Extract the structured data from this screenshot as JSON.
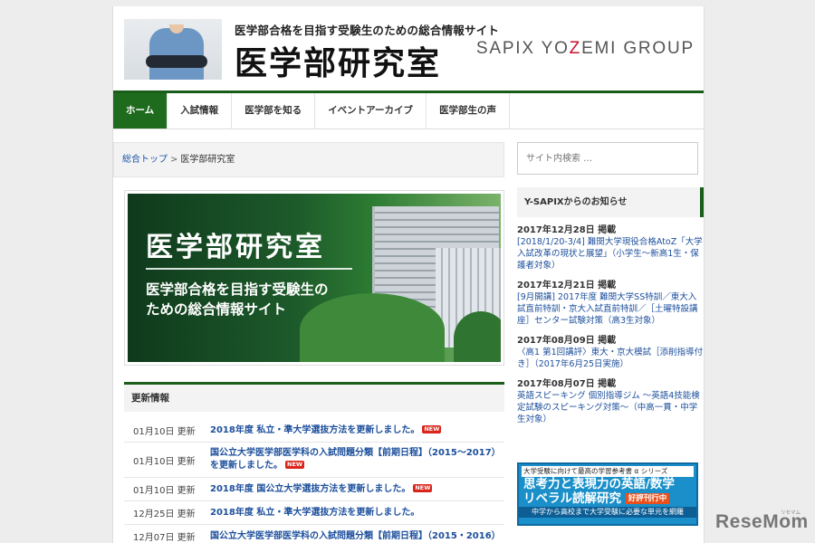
{
  "header": {
    "tagline": "医学部合格を目指す受験生のための総合情報サイト",
    "site_title": "医学部研究室",
    "brand": {
      "prefix": "SAPIX YO",
      "z": "Z",
      "suffix": "EMI GROUP"
    }
  },
  "nav": {
    "items": [
      {
        "label": "ホーム"
      },
      {
        "label": "入試情報"
      },
      {
        "label": "医学部を知る"
      },
      {
        "label": "イベントアーカイブ"
      },
      {
        "label": "医学部生の声"
      }
    ]
  },
  "breadcrumb": {
    "home": "総合トップ",
    "separator": ">",
    "current": "医学部研究室"
  },
  "hero": {
    "title": "医学部研究室",
    "subtitle_line1": "医学部合格を目指す受験生の",
    "subtitle_line2": "ための総合情報サイト"
  },
  "updates": {
    "heading": "更新情報",
    "new_badge": "NEW",
    "rows": [
      {
        "date": "01月10日 更新",
        "text": "2018年度 私立・準大学選抜方法を更新しました。"
      },
      {
        "date": "01月10日 更新",
        "text": "国公立大学医学部医学科の入試問題分類【前期日程】（2015〜2017）を更新しました。"
      },
      {
        "date": "01月10日 更新",
        "text": "2018年度 国公立大学選抜方法を更新しました。"
      },
      {
        "date": "12月25日 更新",
        "text": "2018年度 私立・準大学選抜方法を更新しました。"
      },
      {
        "date": "12月07日 更新",
        "text": "国公立大学医学部医学科の入試問題分類【前期日程】（2015・2016）"
      }
    ]
  },
  "sidebar": {
    "search_placeholder": "サイト内検索 …",
    "news_heading": "Y-SAPIXからのお知らせ",
    "news": [
      {
        "date": "2017年12月28日 掲載",
        "text": "[2018/1/20-3/4] 難関大学現役合格AtoZ「大学入試改革の現状と展望」（小学生～新高1生・保護者対象）"
      },
      {
        "date": "2017年12月21日 掲載",
        "text": "[9月開講] 2017年度 難関大学SS特訓／東大入試直前特訓・京大入試直前特訓／［土曜特設講座］センター試験対策（高3生対象）"
      },
      {
        "date": "2017年08月09日 掲載",
        "text": "〈高1 第1回講評〉東大・京大模試［添削指導付き］（2017年6月25日実施）"
      },
      {
        "date": "2017年08月07日 掲載",
        "text": "英語スピーキング 個別指導ジム ～英語4技能検定試験のスピーキング対策～（中高一貫・中学生対象）"
      }
    ],
    "ad": {
      "top": "大学受験に向けて最高の学習参考書 α シリーズ",
      "line1": "思考力と表現力の英語/数学",
      "line2": "リベラル読解研究",
      "badge": "好評刊行中",
      "bottom": "中学から高校まで大学受験に必要な単元を網羅"
    }
  },
  "watermark": {
    "text": "ReseMom",
    "sub": "リセマム"
  }
}
